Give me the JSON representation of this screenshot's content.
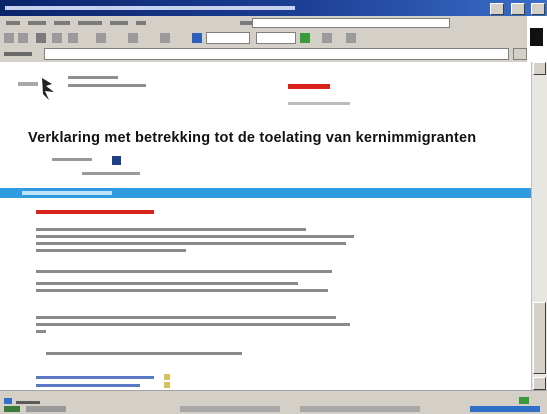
{
  "window": {
    "title": ""
  },
  "menu": {
    "items": [
      "",
      "",
      "",
      "",
      "",
      "",
      "",
      ""
    ]
  },
  "address": {
    "label": "",
    "url": ""
  },
  "page": {
    "home_link": "",
    "org_lines": [
      "",
      ""
    ],
    "brand_name": "",
    "brand_sub": "",
    "title": "Verklaring met betrekking tot de toelating van kernimmigranten",
    "meta": [
      "",
      ""
    ],
    "section_label": "",
    "red_heading": "",
    "paragraphs": [
      "",
      "",
      "",
      "",
      "",
      ""
    ],
    "links": [
      "",
      ""
    ]
  },
  "status": {
    "text": ""
  },
  "colors": {
    "titlebar": "#0a246a",
    "chrome": "#d4d0c8",
    "section_bar": "#2f9be0",
    "accent_red": "#d9241c",
    "link": "#5a78c4"
  }
}
